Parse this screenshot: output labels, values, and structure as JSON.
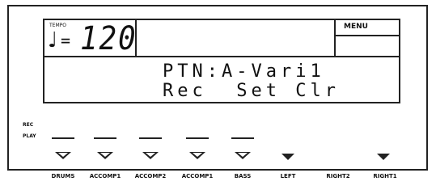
{
  "tempo": {
    "label": "TEMPO",
    "note_symbol": "♩",
    "equals": "=",
    "value": "120"
  },
  "menu": {
    "label": "MENU"
  },
  "display": {
    "line1": "PTN:A-Vari1",
    "line2": "Rec  Set Clr"
  },
  "indicators": {
    "rec_label": "REC",
    "play_label": "PLAY"
  },
  "parts": [
    {
      "label": "DRUMS",
      "button": "open"
    },
    {
      "label": "ACCOMP1",
      "button": "open"
    },
    {
      "label": "ACCOMP2",
      "button": "open"
    },
    {
      "label": "ACCOMP1",
      "button": "open"
    },
    {
      "label": "BASS",
      "button": "open"
    },
    {
      "label": "LEFT",
      "button": "solid"
    },
    {
      "label": "RIGHT2",
      "button": "solid"
    },
    {
      "label": "RIGHT1",
      "button": "solid"
    }
  ]
}
